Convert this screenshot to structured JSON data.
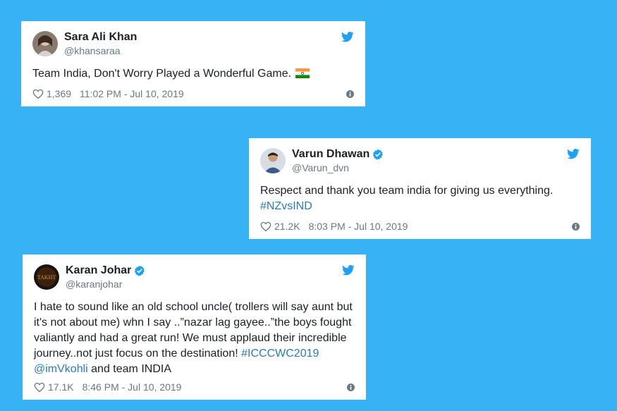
{
  "tweets": [
    {
      "name": "Sara Ali Khan",
      "handle": "@khansaraa",
      "verified": false,
      "text": "Team India, Don't Worry Played a Wonderful Game.",
      "likes": "1,369",
      "timestamp": "11:02 PM - Jul 10, 2019"
    },
    {
      "name": "Varun Dhawan",
      "handle": "@Varun_dvn",
      "verified": true,
      "text": "Respect and thank you team india for giving us everything.",
      "hashtag": "#NZvsIND",
      "likes": "21.2K",
      "timestamp": "8:03 PM - Jul 10, 2019"
    },
    {
      "name": "Karan Johar",
      "handle": "@karanjohar",
      "verified": true,
      "text": "I hate to sound like an old school uncle( trollers will say aunt but it's not about me) whn I say ..”nazar lag gayee..”the boys fought valiantly and had a great run! We must applaud their incredible journey..not just focus on the destination!",
      "hashtag": "#ICCCWC2019",
      "mention": "@imVkohli",
      "text_tail": "and team INDIA",
      "avatar_text": "TAKHT",
      "likes": "17.1K",
      "timestamp": "8:46 PM - Jul 10, 2019"
    }
  ],
  "colors": {
    "background": "#37b3f5",
    "twitter_blue": "#1da1f2",
    "link": "#2b7bb9",
    "verified": "#1da1f2",
    "secondary_text": "#697882"
  },
  "icons": [
    "twitter-bird-icon",
    "heart-icon",
    "info-icon",
    "verified-badge-icon",
    "india-flag-emoji"
  ]
}
